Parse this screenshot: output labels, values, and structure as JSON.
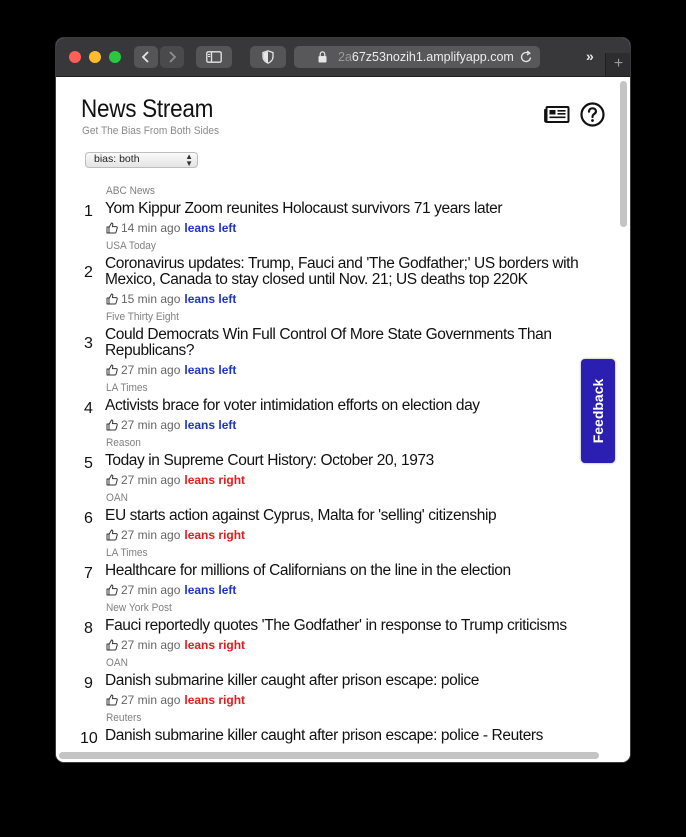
{
  "browser": {
    "url_prefix": "2a",
    "url_main": "67z53nozih1.amplifyapp.com",
    "colors": {
      "close": "#fe5f57",
      "minimize": "#febc2e",
      "zoom": "#28c840"
    }
  },
  "header": {
    "title": "News Stream",
    "subtitle": "Get The Bias From Both Sides"
  },
  "filter": {
    "selected": "bias: both"
  },
  "feedback_label": "Feedback",
  "bias_colors": {
    "left": "#1f33c9",
    "right": "#e31b1b"
  },
  "items": [
    {
      "rank": "1",
      "source": "ABC News",
      "title": "Yom Kippur Zoom reunites Holocaust survivors 71 years later",
      "ago": "14 min ago",
      "bias": "leans left",
      "side": "left"
    },
    {
      "rank": "2",
      "source": "USA Today",
      "title": "Coronavirus updates: Trump, Fauci and 'The Godfather;' US borders with Mexico, Canada to stay closed until Nov. 21; US deaths top 220K",
      "ago": "15 min ago",
      "bias": "leans left",
      "side": "left"
    },
    {
      "rank": "3",
      "source": "Five Thirty Eight",
      "title": "Could Democrats Win Full Control Of More State Governments Than Republicans?",
      "ago": "27 min ago",
      "bias": "leans left",
      "side": "left"
    },
    {
      "rank": "4",
      "source": "LA Times",
      "title": "Activists brace for voter intimidation efforts on election day",
      "ago": "27 min ago",
      "bias": "leans left",
      "side": "left"
    },
    {
      "rank": "5",
      "source": "Reason",
      "title": "Today in Supreme Court History: October 20, 1973",
      "ago": "27 min ago",
      "bias": "leans right",
      "side": "right"
    },
    {
      "rank": "6",
      "source": "OAN",
      "title": "EU starts action against Cyprus, Malta for 'selling' citizenship",
      "ago": "27 min ago",
      "bias": "leans right",
      "side": "right"
    },
    {
      "rank": "7",
      "source": "LA Times",
      "title": "Healthcare for millions of Californians on the line in the election",
      "ago": "27 min ago",
      "bias": "leans left",
      "side": "left"
    },
    {
      "rank": "8",
      "source": "New York Post",
      "title": "Fauci reportedly quotes 'The Godfather' in response to Trump criticisms",
      "ago": "27 min ago",
      "bias": "leans right",
      "side": "right"
    },
    {
      "rank": "9",
      "source": "OAN",
      "title": "Danish submarine killer caught after prison escape: police",
      "ago": "27 min ago",
      "bias": "leans right",
      "side": "right"
    },
    {
      "rank": "10",
      "source": "Reuters",
      "title": "Danish submarine killer caught after prison escape: police - Reuters",
      "ago": "",
      "bias": "",
      "side": ""
    }
  ]
}
